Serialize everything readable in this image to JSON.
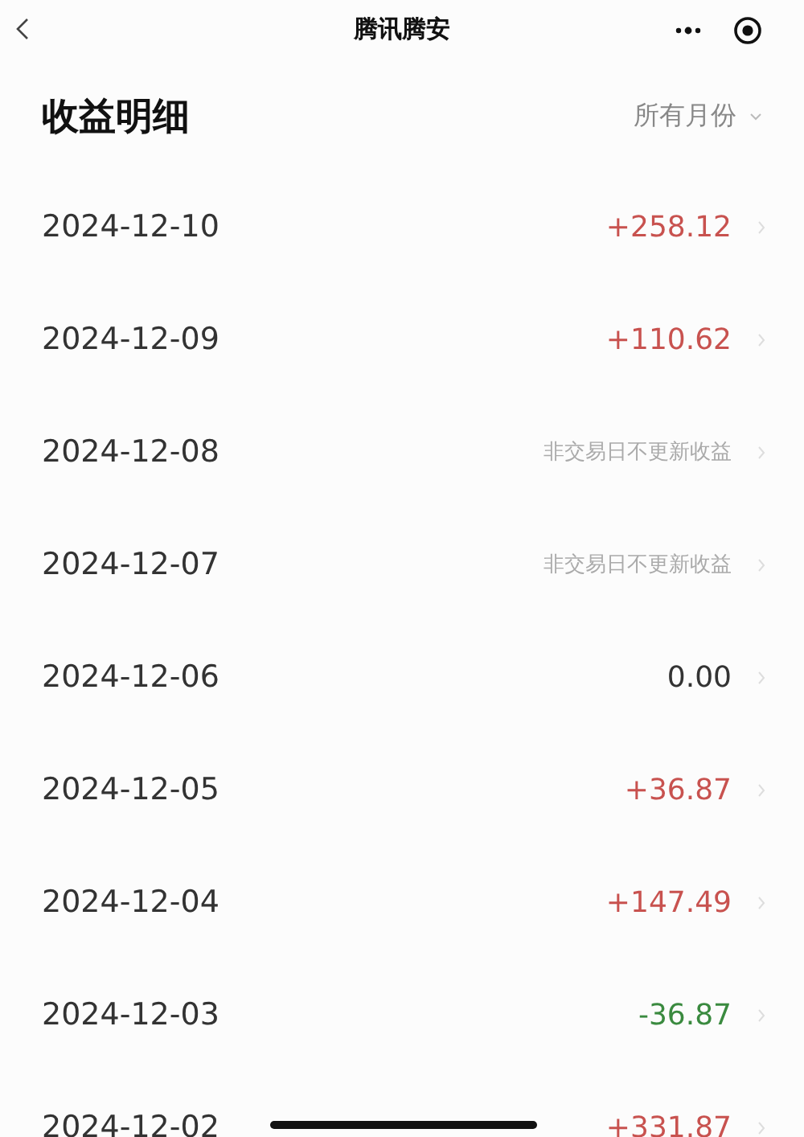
{
  "nav": {
    "title": "腾讯腾安"
  },
  "header": {
    "title": "收益明细",
    "filter": "所有月份"
  },
  "rows": [
    {
      "date": "2024-12-10",
      "amount": "+258.12",
      "kind": "gain"
    },
    {
      "date": "2024-12-09",
      "amount": "+110.62",
      "kind": "gain"
    },
    {
      "date": "2024-12-08",
      "amount": "非交易日不更新收益",
      "kind": "note"
    },
    {
      "date": "2024-12-07",
      "amount": "非交易日不更新收益",
      "kind": "note"
    },
    {
      "date": "2024-12-06",
      "amount": "0.00",
      "kind": "zero"
    },
    {
      "date": "2024-12-05",
      "amount": "+36.87",
      "kind": "gain"
    },
    {
      "date": "2024-12-04",
      "amount": "+147.49",
      "kind": "gain"
    },
    {
      "date": "2024-12-03",
      "amount": "-36.87",
      "kind": "loss"
    },
    {
      "date": "2024-12-02",
      "amount": "+331.87",
      "kind": "gain"
    }
  ]
}
